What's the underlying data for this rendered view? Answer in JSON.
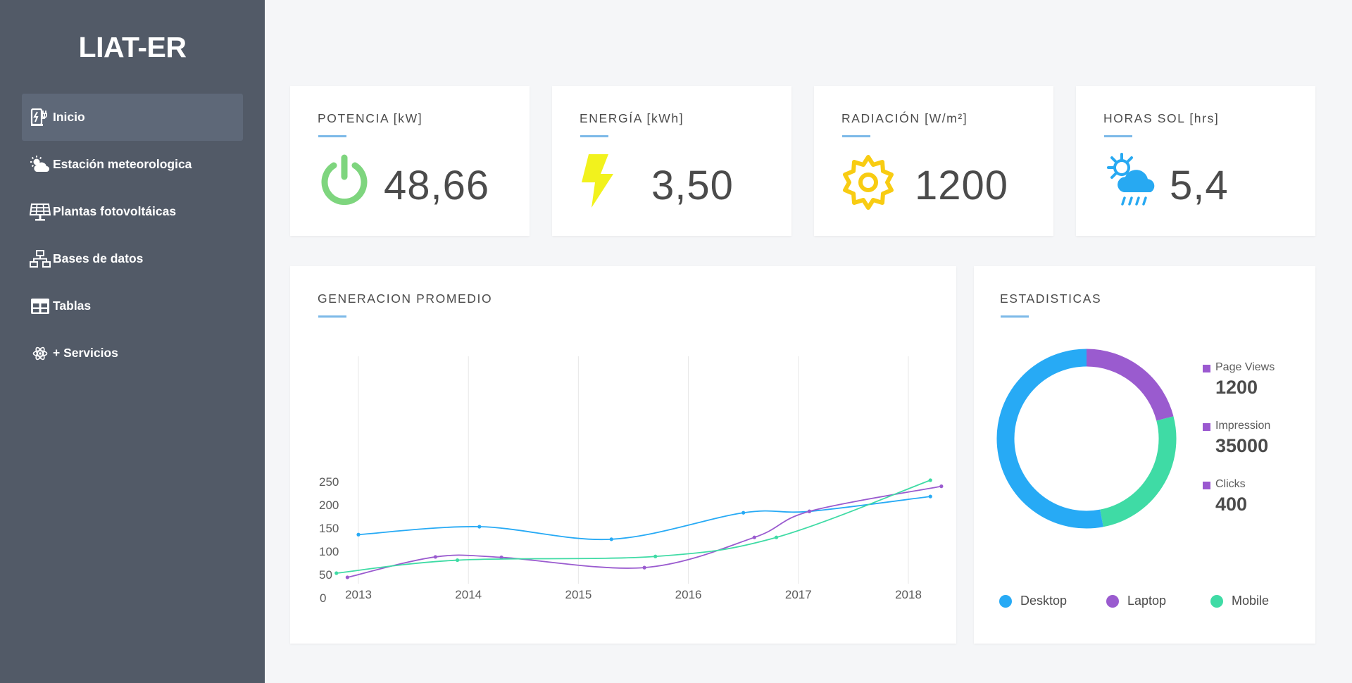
{
  "app": {
    "title": "LIAT-ER"
  },
  "sidebar": {
    "items": [
      {
        "label": "Inicio",
        "icon": "ev-charger-icon",
        "active": true
      },
      {
        "label": "Estación meteorologica",
        "icon": "weather-icon"
      },
      {
        "label": "Plantas fotovoltáicas",
        "icon": "solar-panel-icon"
      },
      {
        "label": "Bases de datos",
        "icon": "network-icon"
      },
      {
        "label": "Tablas",
        "icon": "table-icon"
      },
      {
        "label": "+ Servicios",
        "icon": "atom-icon"
      }
    ]
  },
  "stats": [
    {
      "title": "POTENCIA",
      "unit": "[kW]",
      "value": "48,66",
      "icon": "power-icon",
      "color": "#7ed57e"
    },
    {
      "title": "ENERGÍA",
      "unit": "[kWh]",
      "value": "3,50",
      "icon": "lightning-icon",
      "color": "#f2f21d"
    },
    {
      "title": "RADIACIÓN",
      "unit": "[W/m²]",
      "value": "1200",
      "icon": "sun-icon",
      "color": "#f8cc12"
    },
    {
      "title": "HORAS SOL",
      "unit": "[hrs]",
      "value": "5,4",
      "icon": "sun-cloud-rain-icon",
      "color": "#27a9f2"
    }
  ],
  "line_card": {
    "title": "GENERACION PROMEDIO"
  },
  "donut_card": {
    "title": "ESTADISTICAS",
    "metrics": [
      {
        "label": "Page Views",
        "value": "1200"
      },
      {
        "label": "Impression",
        "value": "35000"
      },
      {
        "label": "Clicks",
        "value": "400"
      }
    ],
    "legend": [
      {
        "label": "Desktop",
        "color": "#27aaf5"
      },
      {
        "label": "Laptop",
        "color": "#9a5bcf"
      },
      {
        "label": "Mobile",
        "color": "#3fdba5"
      }
    ]
  },
  "chart_data": [
    {
      "type": "line",
      "title": "GENERACION PROMEDIO",
      "xlabel": "",
      "ylabel": "",
      "x_ticks": [
        "2013",
        "2014",
        "2015",
        "2016",
        "2017",
        "2018"
      ],
      "y_ticks": [
        0,
        50,
        100,
        150,
        200,
        250
      ],
      "ylim": [
        0,
        250
      ],
      "grid": "vertical",
      "series": [
        {
          "color": "#27aaf5",
          "points": [
            [
              2013.0,
              136
            ],
            [
              2014.1,
              153
            ],
            [
              2015.3,
              126
            ],
            [
              2016.5,
              183
            ],
            [
              2017.1,
              186
            ],
            [
              2018.2,
              218
            ]
          ]
        },
        {
          "color": "#9a5bcf",
          "points": [
            [
              2012.9,
              44
            ],
            [
              2013.7,
              88
            ],
            [
              2014.3,
              87
            ],
            [
              2015.6,
              65
            ],
            [
              2016.6,
              130
            ],
            [
              2017.1,
              186
            ],
            [
              2018.3,
              240
            ]
          ]
        },
        {
          "color": "#3fdba5",
          "points": [
            [
              2012.8,
              53
            ],
            [
              2013.9,
              81
            ],
            [
              2015.7,
              89
            ],
            [
              2016.8,
              130
            ],
            [
              2018.2,
              253
            ]
          ]
        }
      ]
    },
    {
      "type": "pie",
      "subtype": "donut",
      "labels": [
        "Desktop",
        "Laptop",
        "Mobile"
      ],
      "values": [
        53,
        21,
        26
      ],
      "colors": [
        "#27aaf5",
        "#9a5bcf",
        "#3fdba5"
      ],
      "legend": "bottom"
    }
  ]
}
